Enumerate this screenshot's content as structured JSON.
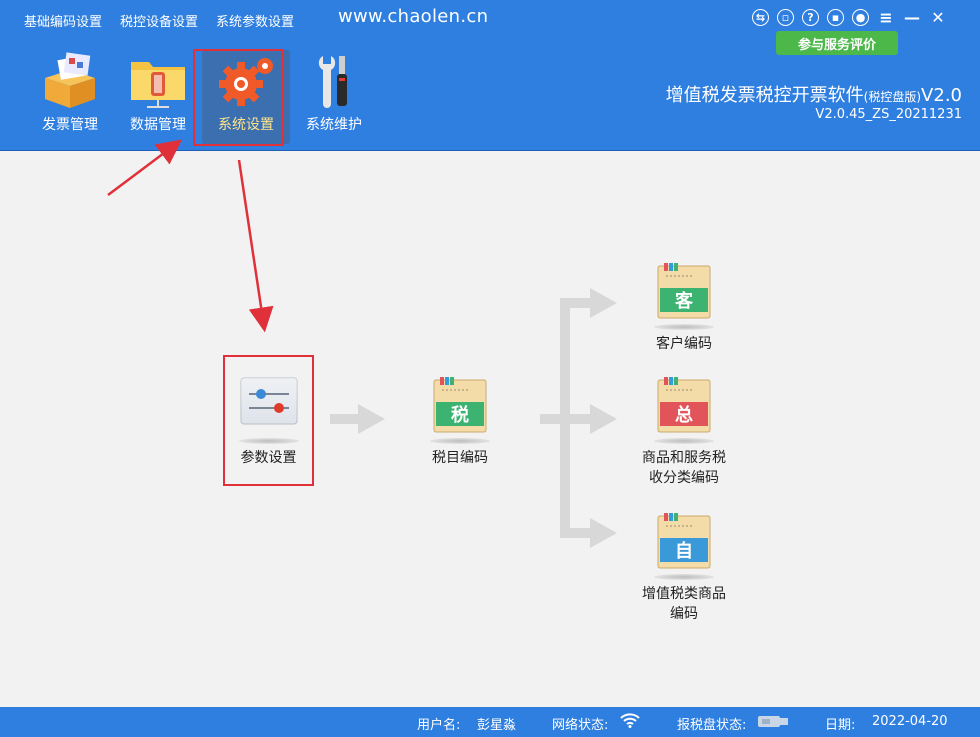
{
  "top_menu": [
    "基础编码设置",
    "税控设备设置",
    "系统参数设置"
  ],
  "site_url": "www.chaolen.cn",
  "window_controls": [
    "swap-icon",
    "feedback-icon",
    "help-icon",
    "lock-icon",
    "user-icon",
    "menu-icon",
    "minimize-icon",
    "close-icon"
  ],
  "eval_button": "参与服务评价",
  "toolbar": [
    {
      "label": "发票管理",
      "icon": "invoice-box-icon"
    },
    {
      "label": "数据管理",
      "icon": "data-folder-icon"
    },
    {
      "label": "系统设置",
      "icon": "gear-icon"
    },
    {
      "label": "系统维护",
      "icon": "wrench-screwdriver-icon"
    }
  ],
  "app": {
    "title_main": "增值税发票税控开票软件",
    "title_small": "(税控盘版)",
    "title_suffix": "V2.0",
    "version": "V2.0.45_ZS_20211231"
  },
  "flow": {
    "param": "参数设置",
    "tax_item": "税目编码",
    "tax_item_char": "税",
    "customer": "客户编码",
    "customer_char": "客",
    "goods_line1": "商品和服务税",
    "goods_line2": "收分类编码",
    "goods_char": "总",
    "vat_line1": "增值税类商品",
    "vat_line2": "编码",
    "vat_char": "自"
  },
  "status": {
    "user_label": "用户名:",
    "user_value": "彭星淼",
    "network_label": "网络状态:",
    "disk_label": "报税盘状态:",
    "date_label": "日期:",
    "date_value": "2022-04-20"
  },
  "colors": {
    "header": "#2f7fe0",
    "highlight_box": "#e0303a",
    "eval_button": "#4cb84a",
    "green_tab": "#3cb371",
    "red_tab": "#e0545a",
    "blue_tab": "#3a9ad9"
  }
}
